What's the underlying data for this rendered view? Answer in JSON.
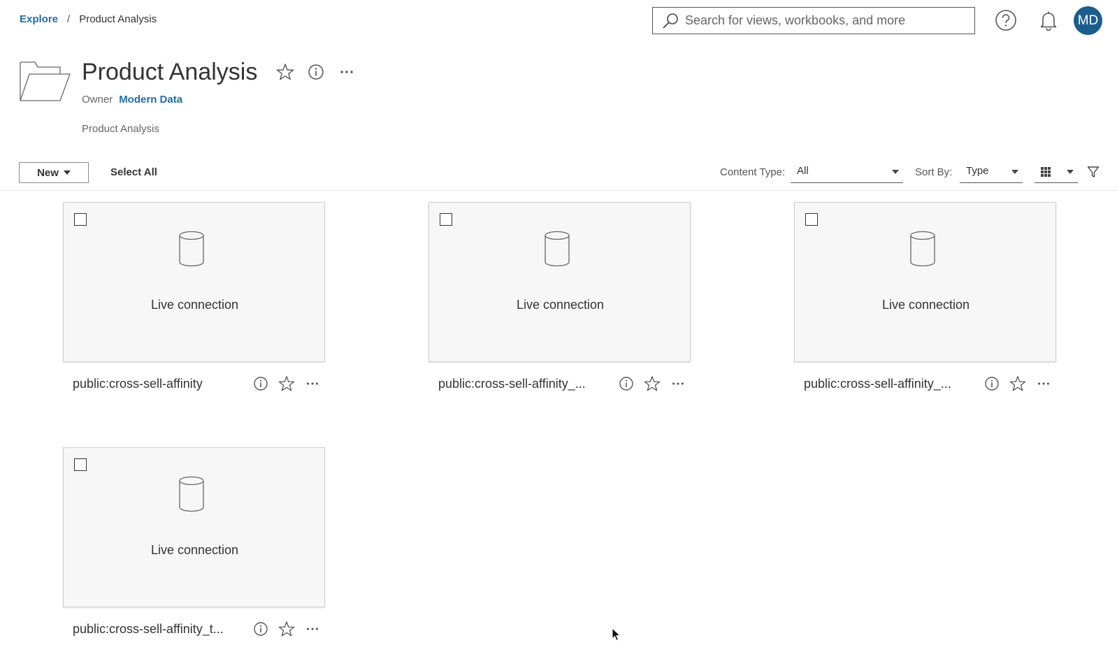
{
  "breadcrumb": {
    "root": "Explore",
    "separator": "/",
    "current": "Product Analysis"
  },
  "search": {
    "placeholder": "Search for views, workbooks, and more"
  },
  "user": {
    "initials": "MD",
    "avatar_color": "#1b5e8e"
  },
  "project": {
    "title": "Product Analysis",
    "owner_label": "Owner",
    "owner_name": "Modern Data",
    "description": "Product Analysis"
  },
  "toolbar": {
    "new_label": "New",
    "select_all_label": "Select All",
    "content_type_label": "Content Type:",
    "content_type_value": "All",
    "sort_by_label": "Sort By:",
    "sort_by_value": "Type"
  },
  "cards": [
    {
      "name": "public:cross-sell-affinity",
      "status": "Live connection"
    },
    {
      "name": "public:cross-sell-affinity_...",
      "status": "Live connection"
    },
    {
      "name": "public:cross-sell-affinity_...",
      "status": "Live connection"
    },
    {
      "name": "public:cross-sell-affinity_t...",
      "status": "Live connection"
    }
  ],
  "colors": {
    "link": "#1f6ea8",
    "text": "#333333"
  },
  "icons": [
    "search-icon",
    "help-icon",
    "bell-icon",
    "folder-icon",
    "star-icon",
    "info-icon",
    "more-icon",
    "database-icon",
    "grid-view-icon",
    "filter-icon"
  ]
}
